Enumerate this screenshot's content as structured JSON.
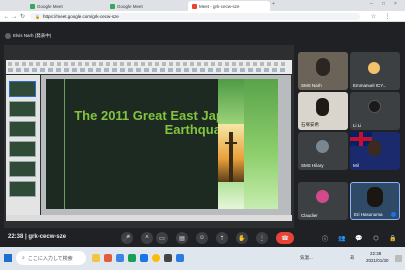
{
  "browser": {
    "tabs": [
      {
        "label": "Google Meet"
      },
      {
        "label": "Google Meet"
      },
      {
        "label": "Meet - grk-cecw-sze"
      }
    ],
    "url": "https://meet.google.com/grk-cecw-sze"
  },
  "meet": {
    "presenter": "Elvis Narh (発表中)",
    "meeting_code": "grk-cecw-sze",
    "time": "22:38",
    "slide_title": "The 2011 Great East Japan Earthquake.",
    "participants": [
      {
        "name": "SMS Narh"
      },
      {
        "name": "Emmanuel ICY..."
      },
      {
        "name": "石塚安希"
      },
      {
        "name": "Li Li"
      },
      {
        "name": "SMS Hilary"
      },
      {
        "name": "Mil"
      },
      {
        "name": "Claudier"
      },
      {
        "name": "Eri Hasunuma"
      }
    ]
  },
  "taskbar": {
    "search_placeholder": "ここに入力して検索",
    "time": "22:38",
    "date": "2021/01/30",
    "lang": "あ",
    "weather": "気温..."
  },
  "colors": {
    "accent_green": "#82c43d",
    "end_call": "#ea4335",
    "pin_blue": "#1a73e8"
  }
}
